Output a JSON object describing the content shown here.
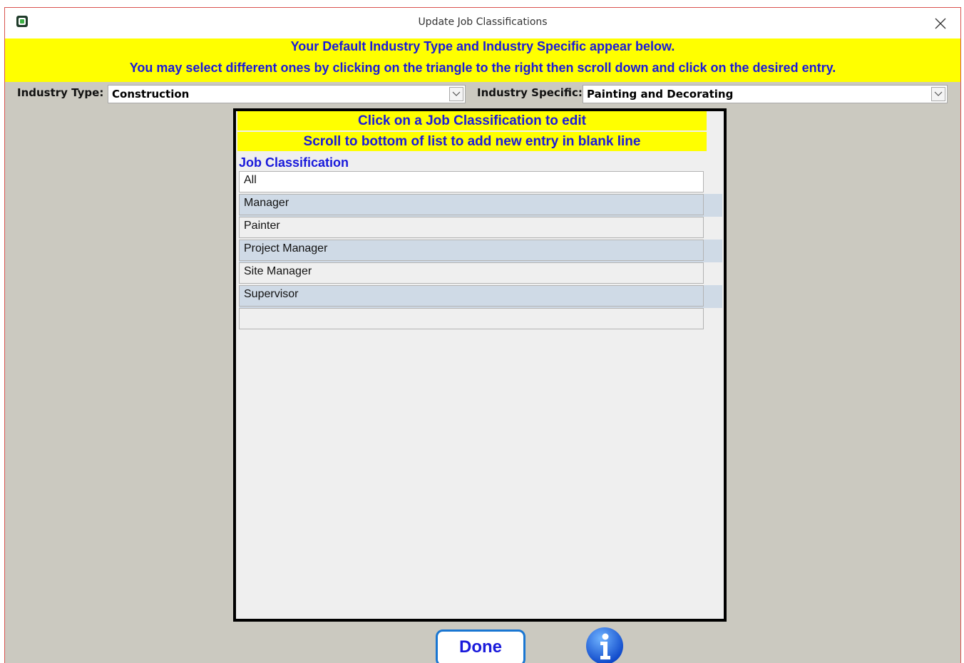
{
  "window": {
    "title": "Update Job Classifications"
  },
  "banner": {
    "line1": "Your Default Industry Type and Industry Specific appear below.",
    "line2": "You may select different ones by clicking on the triangle to the right then scroll down  and click on the desired entry."
  },
  "industry_type": {
    "label": "Industry Type:",
    "value": "Construction"
  },
  "industry_specific": {
    "label": "Industry Specific:",
    "value": "Painting and Decorating"
  },
  "panel": {
    "instruction1": "Click on a Job Classification to edit",
    "instruction2": "Scroll to bottom of list to add new entry in blank line",
    "column_header": "Job Classification",
    "rows": [
      "All",
      "Manager",
      "Painter",
      "Project Manager",
      "Site Manager",
      "Supervisor",
      ""
    ]
  },
  "buttons": {
    "done": "Done",
    "info_icon": "info-icon"
  },
  "colors": {
    "banner": "#ffff00",
    "banner_text": "#1a1adb",
    "window_bg": "#cbc9c0",
    "row_alt": "#cfdae6"
  }
}
